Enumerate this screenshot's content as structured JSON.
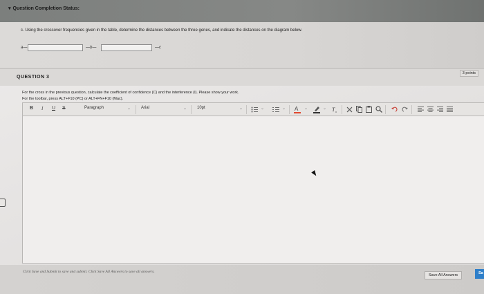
{
  "header": {
    "caret": "▾",
    "title": "Question Completion Status:"
  },
  "part_c": {
    "question": "c. Using the crossover frequencies given in the table, determine the distances between the three genes, and indicate the distances on the diagram below.",
    "genes": [
      "a",
      "b",
      "c"
    ],
    "distance_1": "",
    "distance_2": ""
  },
  "question3": {
    "title": "QUESTION 3",
    "points": "3 points",
    "text": "For the cross in the previous question, calculate the coefficient of confidence (C) and the interference (I). Please show your work.",
    "hint": "For the toolbar, press ALT+F10 (PC) or ALT+FN+F10 (Mac)."
  },
  "toolbar": {
    "bold": "B",
    "italic": "I",
    "underline": "U",
    "strike": "S",
    "paragraph": "Paragraph",
    "font": "Arial",
    "size": "10pt",
    "chevron": "⌄"
  },
  "editor": {
    "content": ""
  },
  "footer": {
    "instructions": "Click Save and Submit to save and submit. Click Save All Answers to save all answers.",
    "save_all": "Save All Answers",
    "submit": "Sa"
  }
}
